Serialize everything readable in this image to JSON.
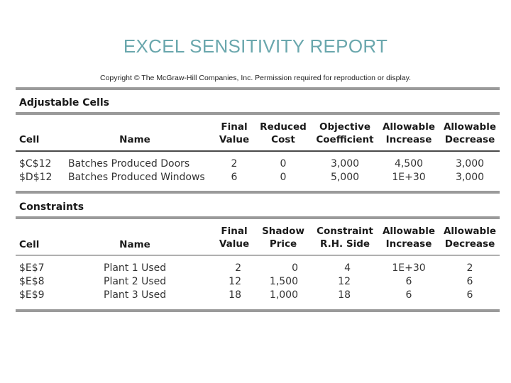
{
  "title": "EXCEL SENSITIVITY REPORT",
  "copyright": "Copyright © The McGraw-Hill Companies, Inc. Permission required for reproduction or display.",
  "adjustable": {
    "section_title": "Adjustable Cells",
    "headers": {
      "cell": "Cell",
      "name": "Name",
      "final_1": "Final",
      "final_2": "Value",
      "reduced_1": "Reduced",
      "reduced_2": "Cost",
      "objective_1": "Objective",
      "objective_2": "Coefficient",
      "inc_1": "Allowable",
      "inc_2": "Increase",
      "dec_1": "Allowable",
      "dec_2": "Decrease"
    },
    "rows": [
      {
        "cell": "$C$12",
        "name": "Batches Produced Doors",
        "final": "2",
        "reduced": "0",
        "objective": "3,000",
        "inc": "4,500",
        "dec": "3,000"
      },
      {
        "cell": "$D$12",
        "name": "Batches Produced Windows",
        "final": "6",
        "reduced": "0",
        "objective": "5,000",
        "inc": "1E+30",
        "dec": "3,000"
      }
    ]
  },
  "constraints": {
    "section_title": "Constraints",
    "headers": {
      "cell": "Cell",
      "name": "Name",
      "final_1": "Final",
      "final_2": "Value",
      "shadow_1": "Shadow",
      "shadow_2": "Price",
      "rhs_1": "Constraint",
      "rhs_2": "R.H. Side",
      "inc_1": "Allowable",
      "inc_2": "Increase",
      "dec_1": "Allowable",
      "dec_2": "Decrease"
    },
    "rows": [
      {
        "cell": "$E$7",
        "name": "Plant 1 Used",
        "final": "2",
        "shadow": "0",
        "rhs": "4",
        "inc": "1E+30",
        "dec": "2"
      },
      {
        "cell": "$E$8",
        "name": "Plant 2 Used",
        "final": "12",
        "shadow": "1,500",
        "rhs": "12",
        "inc": "6",
        "dec": "6"
      },
      {
        "cell": "$E$9",
        "name": "Plant 3 Used",
        "final": "18",
        "shadow": "1,000",
        "rhs": "18",
        "inc": "6",
        "dec": "6"
      }
    ]
  }
}
